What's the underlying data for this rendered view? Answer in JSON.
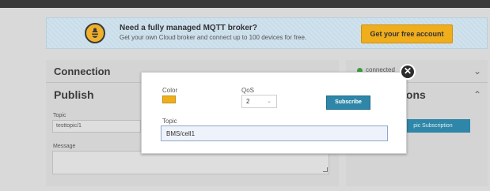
{
  "banner": {
    "title": "Need a fully managed MQTT broker?",
    "subtitle": "Get your own Cloud broker and connect up to 100 devices for free.",
    "cta_label": "Get your free account",
    "logo_icon": "bee-logo-icon"
  },
  "connection": {
    "title": "Connection",
    "status_text": "connected",
    "status_color": "#3b9d3b"
  },
  "publish": {
    "title": "Publish",
    "topic_label": "Topic",
    "topic_value": "testtopic/1",
    "message_label": "Message"
  },
  "subscriptions": {
    "title_partial": "ions",
    "add_button_partial": "pic Subscription"
  },
  "modal": {
    "color_label": "Color",
    "color_value": "#f0ad1c",
    "qos_label": "QoS",
    "qos_selected": "2",
    "subscribe_label": "Subscribe",
    "topic_label": "Topic",
    "topic_value": "BMS/cell1",
    "close_glyph": "✕"
  },
  "colors": {
    "accent": "#2e86a8",
    "cta": "#f0ad1c"
  }
}
